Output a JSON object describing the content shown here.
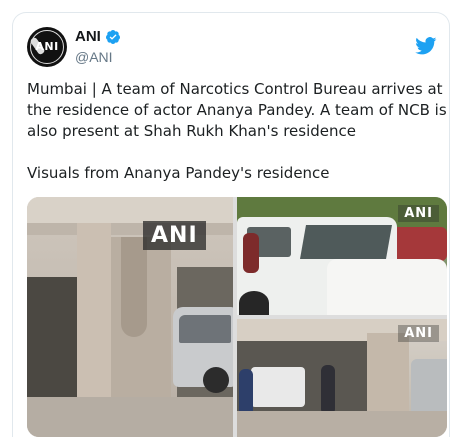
{
  "author": {
    "display_name": "ANI",
    "handle": "@ANI",
    "avatar_text": "ANI",
    "verified": true
  },
  "tweet": {
    "paragraphs": [
      "Mumbai | A team of Narcotics Control Bureau arrives at the residence of actor Ananya Pandey. A team of NCB is also present at Shah Rukh Khan's residence",
      "Visuals from Ananya Pandey's residence"
    ]
  },
  "media": {
    "watermark": "ANI",
    "images": [
      {
        "name": "parking-garage-photo"
      },
      {
        "name": "white-suv-photo"
      },
      {
        "name": "garage-entrance-photo"
      }
    ]
  },
  "colors": {
    "twitter_blue": "#1da1f2",
    "text": "#14171a",
    "secondary": "#657786",
    "border": "#e1e8ed"
  },
  "icons": [
    "twitter-bird-icon",
    "verified-badge-icon"
  ]
}
